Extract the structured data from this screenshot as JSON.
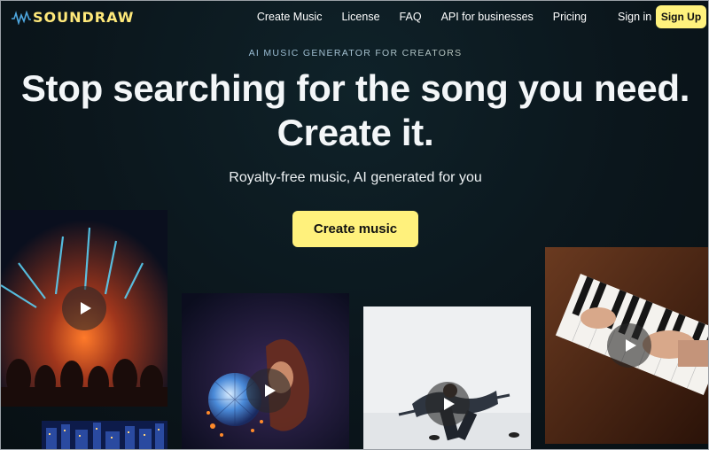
{
  "brand": {
    "name": "SOUNDRAW",
    "accent": "#fff17c"
  },
  "nav": {
    "links": [
      "Create Music",
      "License",
      "FAQ",
      "API for businesses",
      "Pricing"
    ],
    "sign_in": "Sign in",
    "sign_up": "Sign Up"
  },
  "hero": {
    "eyebrow": "AI MUSIC GENERATOR FOR CREATORS",
    "headline_line1": "Stop searching for the song you need.",
    "headline_line2": "Create it.",
    "subhead": "Royalty-free music, AI generated for you",
    "cta": "Create music"
  },
  "tiles": [
    {
      "name": "concert-crowd",
      "icon": "play-icon"
    },
    {
      "name": "disco-ball-singer",
      "icon": "play-icon"
    },
    {
      "name": "dancer-jumping",
      "icon": "play-icon"
    },
    {
      "name": "piano-hands",
      "icon": "play-icon"
    },
    {
      "name": "city-night",
      "icon": "none"
    }
  ]
}
